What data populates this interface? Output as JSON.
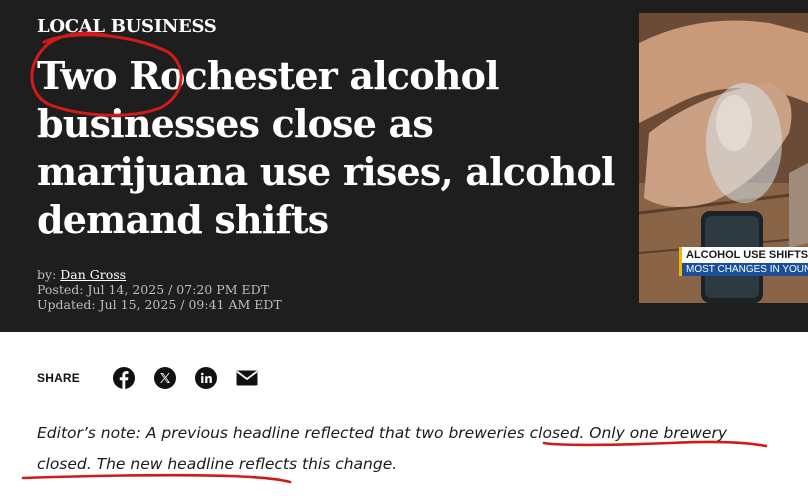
{
  "article": {
    "kicker": "LOCAL BUSINESS",
    "headline": "Two Rochester alcohol businesses close as marijuana use rises, alcohol demand shifts",
    "byline_prefix": "by:",
    "author": "Dan Gross",
    "posted": "Posted: Jul 14, 2025 / 07:20 PM EDT",
    "updated": "Updated: Jul 15, 2025 / 09:41 AM EDT"
  },
  "video": {
    "chyron_title": "ALCOHOL USE SHIFTS",
    "chyron_subtitle": "MOST CHANGES IN YOUNG"
  },
  "share": {
    "label": "SHARE",
    "icons": [
      "facebook-icon",
      "x-icon",
      "linkedin-icon",
      "email-icon"
    ]
  },
  "note": {
    "prefix": "Editor’s note: A previous headline reflected that two breweries closed.",
    "correction": "Only one brewery closed. The new headline reflects this change."
  },
  "colors": {
    "hero_bg": "#1e1e1e",
    "annotation_red": "#d11a1a"
  }
}
